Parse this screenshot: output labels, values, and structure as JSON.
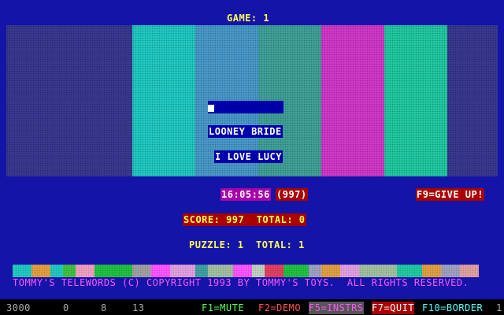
{
  "header": {
    "game_label": "GAME: 1"
  },
  "colors": {
    "background": "#1414a8",
    "bars": [
      "#383890",
      "#20c8c0",
      "#4898c8",
      "#40a098",
      "#d038c8",
      "#20c8a0",
      "#383890"
    ],
    "strip": [
      "#20c8c0",
      "#e0a040",
      "#20c8c0",
      "#40c040",
      "#f0a0c0",
      "#20c040",
      "#a0a0a0",
      "#ff55ff",
      "#e0a0e0",
      "#40a0a0",
      "#a0c0a0",
      "#ff55ff",
      "#c0d0c0",
      "#e04060",
      "#20c040",
      "#a0a0c0",
      "#e0a040",
      "#e0a0e0",
      "#a0c0a0",
      "#20c8a0",
      "#e0a040",
      "#a0a0c0",
      "#e0a0a0"
    ]
  },
  "puzzle": {
    "current_answer": "",
    "clues": [
      "LOONEY BRIDE",
      "I LOVE LUCY"
    ]
  },
  "timer": {
    "clock": "16:05:56",
    "points": "(997)"
  },
  "give_up": "F9=GIVE UP!",
  "score_line": "SCORE: 997  TOTAL: 0",
  "puzzle_line": "PUZZLE: 1  TOTAL: 1",
  "copyright": "TOMMY'S TELEWORDS (C) COPYRIGHT 1993 BY TOMMY'S TOYS.  ALL RIGHTS RESERVED.",
  "status_bar": {
    "numbers": [
      "3000",
      "0",
      "8",
      "13"
    ],
    "keys": {
      "mute": "F1=MUTE",
      "demo": "F2=DEMO",
      "instrs": "F5=INSTRS",
      "quit": "F7=QUIT",
      "border": "F10=BORDER"
    },
    "trailing": "1"
  }
}
